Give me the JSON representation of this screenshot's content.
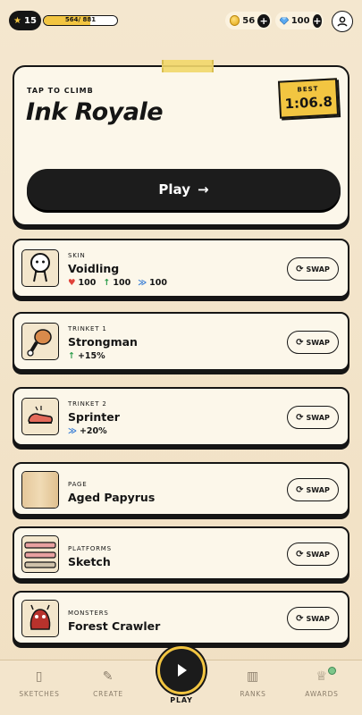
{
  "status": {
    "level": "15",
    "xp_text": "564/ 881",
    "xp_progress": 0.64,
    "coins": "56",
    "gems": "100"
  },
  "hero": {
    "kicker": "TAP TO CLIMB",
    "title": "Ink Royale",
    "best_label": "BEST",
    "best_time": "1:06.8",
    "play_label": "Play",
    "play_arrow": "→"
  },
  "loadout": [
    {
      "kicker": "SKIN",
      "name": "Voidling",
      "stats": [
        {
          "icon": "heart",
          "value": "100"
        },
        {
          "icon": "arrow-up",
          "value": "100"
        },
        {
          "icon": "wing",
          "value": "100"
        }
      ],
      "swap": "SWAP"
    },
    {
      "kicker": "TRINKET 1",
      "name": "Strongman",
      "stats": [
        {
          "icon": "arrow-up",
          "value": "+15%"
        }
      ],
      "swap": "SWAP"
    },
    {
      "kicker": "TRINKET 2",
      "name": "Sprinter",
      "stats": [
        {
          "icon": "wing",
          "value": "+20%"
        }
      ],
      "swap": "SWAP"
    },
    {
      "kicker": "PAGE",
      "name": "Aged Papyrus",
      "swap": "SWAP"
    },
    {
      "kicker": "PLATFORMS",
      "name": "Sketch",
      "swap": "SWAP"
    },
    {
      "kicker": "MONSTERS",
      "name": "Forest Crawler",
      "swap": "SWAP"
    }
  ],
  "nav": {
    "sketches": "SKETCHES",
    "create": "CREATE",
    "play": "PLAY",
    "ranks": "RANKS",
    "awards": "AWARDS"
  },
  "colors": {
    "accent": "#f2c541",
    "ink": "#151515",
    "card": "#fcf7ea",
    "background": "#f4e7cf"
  }
}
